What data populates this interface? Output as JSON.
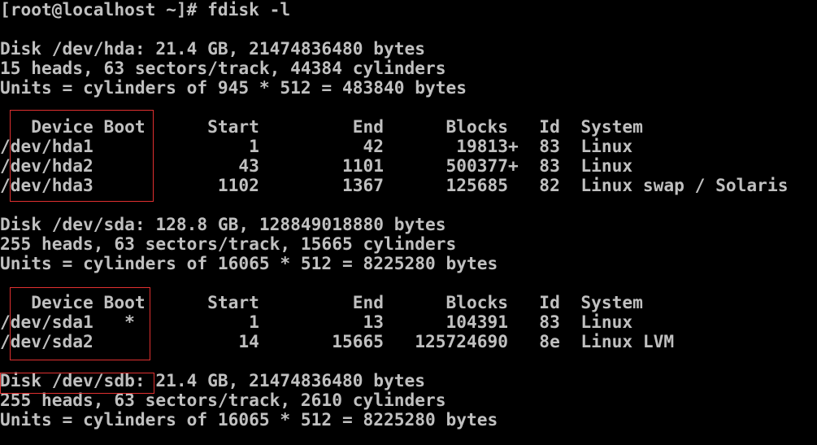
{
  "terminal": {
    "prompt_line": "[root@localhost ~]# fdisk -l",
    "lines": [
      "",
      "Disk /dev/hda: 21.4 GB, 21474836480 bytes",
      "15 heads, 63 sectors/track, 44384 cylinders",
      "Units = cylinders of 945 * 512 = 483840 bytes",
      "",
      "   Device Boot      Start         End      Blocks   Id  System",
      "/dev/hda1               1          42       19813+  83  Linux",
      "/dev/hda2              43        1101      500377+  83  Linux",
      "/dev/hda3            1102        1367      125685   82  Linux swap / Solaris",
      "",
      "Disk /dev/sda: 128.8 GB, 128849018880 bytes",
      "255 heads, 63 sectors/track, 15665 cylinders",
      "Units = cylinders of 16065 * 512 = 8225280 bytes",
      "",
      "   Device Boot      Start         End      Blocks   Id  System",
      "/dev/sda1   *           1          13      104391   83  Linux",
      "/dev/sda2              14       15665   125724690   8e  Linux LVM",
      "",
      "Disk /dev/sdb: 21.4 GB, 21474836480 bytes",
      "255 heads, 63 sectors/track, 2610 cylinders",
      "Units = cylinders of 16065 * 512 = 8225280 bytes"
    ]
  },
  "colors": {
    "background": "#000000",
    "text": "#c0c0c0",
    "highlight_box": "#e03030"
  }
}
